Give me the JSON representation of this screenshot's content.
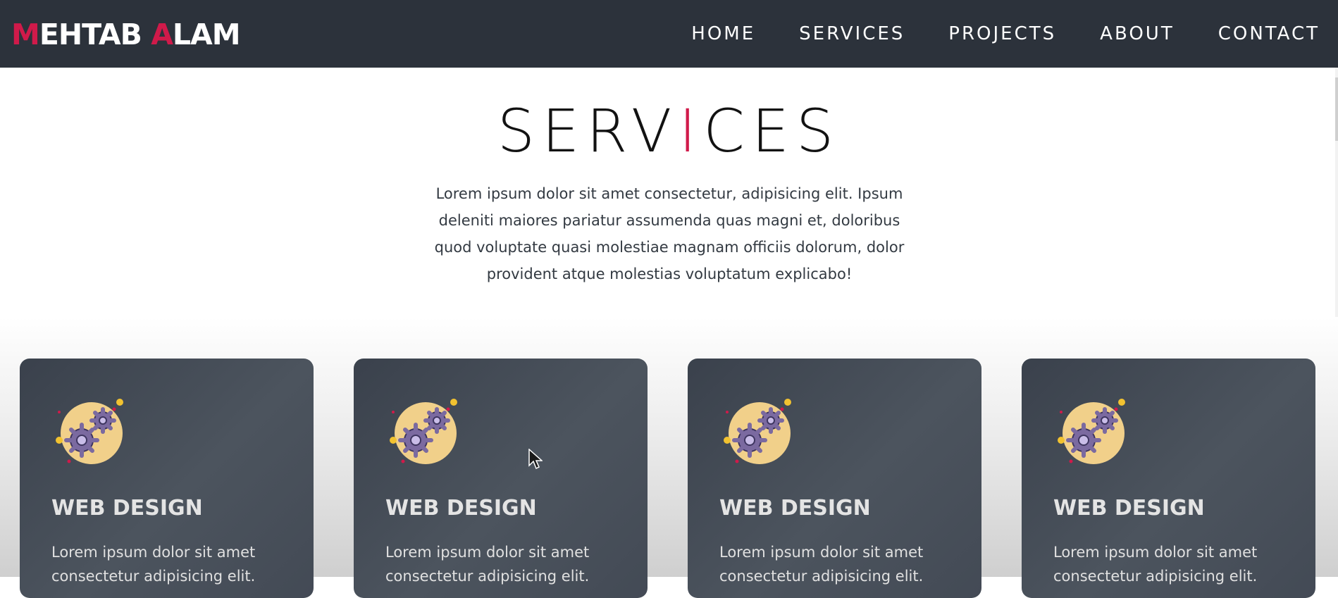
{
  "logo": {
    "first_initial": "M",
    "first_rest": "EHTAB ",
    "last_initial": "A",
    "last_rest": "LAM"
  },
  "nav": {
    "items": [
      {
        "label": "HOME"
      },
      {
        "label": "SERVICES"
      },
      {
        "label": "PROJECTS"
      },
      {
        "label": "ABOUT"
      },
      {
        "label": "CONTACT"
      }
    ]
  },
  "section": {
    "title_start": "SERV",
    "title_accent": "I",
    "title_end": "CES",
    "intro_lines": [
      "Lorem ipsum dolor sit amet consectetur, adipisicing elit. Ipsum",
      "deleniti maiores pariatur assumenda quas magni et, doloribus",
      "quod voluptate quasi molestiae magnam officiis dolorum, dolor",
      "provident atque molestias voluptatum explicabo!"
    ]
  },
  "cards": [
    {
      "title": "WEB DESIGN",
      "text": "Lorem ipsum dolor sit amet consectetur adipisicing elit.",
      "icon": "gears-icon"
    },
    {
      "title": "WEB DESIGN",
      "text": "Lorem ipsum dolor sit amet consectetur adipisicing elit.",
      "icon": "gears-icon"
    },
    {
      "title": "WEB DESIGN",
      "text": "Lorem ipsum dolor sit amet consectetur adipisicing elit.",
      "icon": "gears-icon"
    },
    {
      "title": "WEB DESIGN",
      "text": "Lorem ipsum dolor sit amet consectetur adipisicing elit.",
      "icon": "gears-icon"
    }
  ],
  "colors": {
    "navbar_bg": "#2c323b",
    "accent": "#d01a4a",
    "card_bg": "#434a55",
    "icon_circle": "#f1d08a",
    "gear": "#7b6aa0"
  }
}
